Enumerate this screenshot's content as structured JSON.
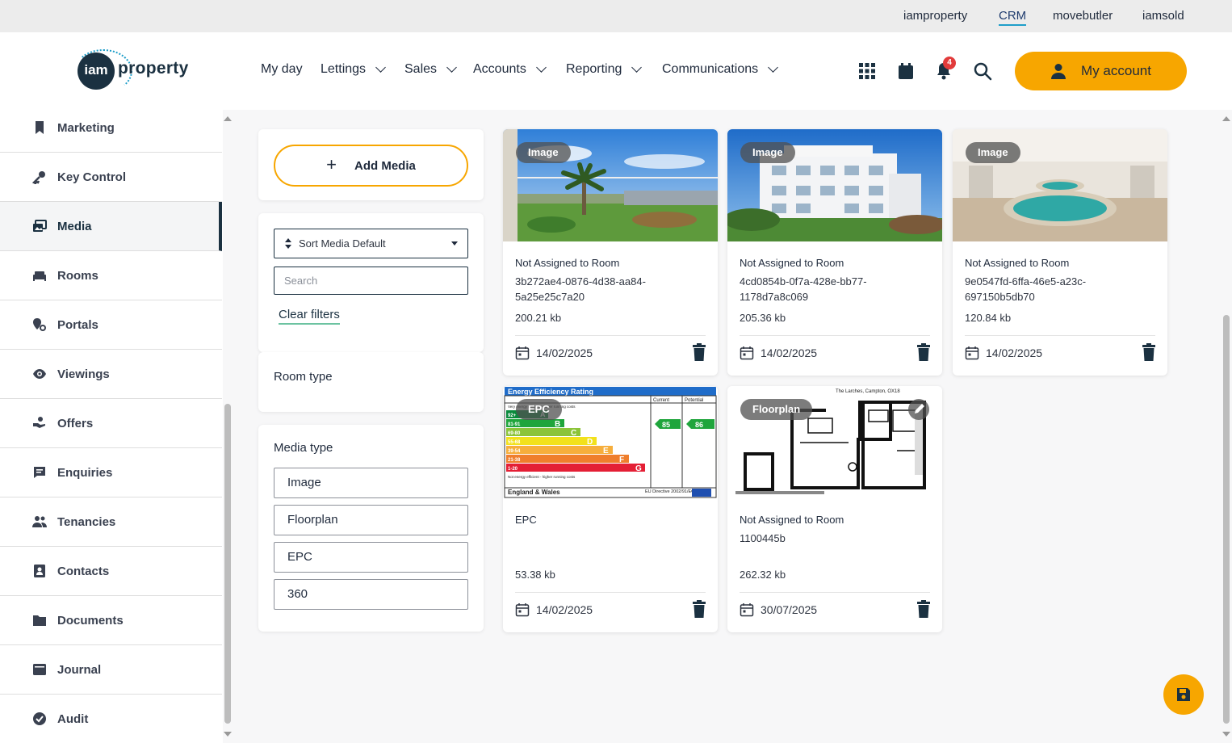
{
  "top_links": [
    "iamproperty",
    "CRM",
    "movebutler",
    "iamsold"
  ],
  "logo": {
    "mark": "iam",
    "word": "property"
  },
  "nav": [
    "My day",
    "Lettings",
    "Sales",
    "Accounts",
    "Reporting",
    "Communications"
  ],
  "notifications_count": "4",
  "account_label": "My account",
  "sidebar": [
    {
      "label": "Marketing",
      "icon": "bookmark-icon"
    },
    {
      "label": "Key Control",
      "icon": "key-icon"
    },
    {
      "label": "Media",
      "icon": "media-icon",
      "active": true
    },
    {
      "label": "Rooms",
      "icon": "bed-icon"
    },
    {
      "label": "Portals",
      "icon": "portal-icon"
    },
    {
      "label": "Viewings",
      "icon": "eye-icon"
    },
    {
      "label": "Offers",
      "icon": "hand-coin-icon"
    },
    {
      "label": "Enquiries",
      "icon": "message-icon"
    },
    {
      "label": "Tenancies",
      "icon": "people-icon"
    },
    {
      "label": "Contacts",
      "icon": "contact-card-icon"
    },
    {
      "label": "Documents",
      "icon": "folder-icon"
    },
    {
      "label": "Journal",
      "icon": "journal-icon"
    },
    {
      "label": "Audit",
      "icon": "check-circle-icon"
    }
  ],
  "filters": {
    "add_media": "Add Media",
    "sort_value": "Sort Media Default",
    "search_placeholder": "Search",
    "clear_filters": "Clear filters",
    "room_type_title": "Room type",
    "media_type_title": "Media type",
    "media_types": [
      "Image",
      "Floorplan",
      "EPC",
      "360"
    ]
  },
  "media": [
    {
      "tag": "Image",
      "room": "Not Assigned to Room",
      "id": "3b272ae4-0876-4d38-aa84-5a25e25c7a20",
      "size": "200.21 kb",
      "date": "14/02/2025"
    },
    {
      "tag": "Image",
      "room": "Not Assigned to Room",
      "id": "4cd0854b-0f7a-428e-bb77-1178d7a8c069",
      "size": "205.36 kb",
      "date": "14/02/2025"
    },
    {
      "tag": "Image",
      "room": "Not Assigned to Room",
      "id": "9e0547fd-6ffa-46e5-a23c-697150b5db70",
      "size": "120.84 kb",
      "date": "14/02/2025"
    },
    {
      "tag": "EPC",
      "room": "EPC",
      "id": "",
      "size": "53.38 kb",
      "date": "14/02/2025"
    },
    {
      "tag": "Floorplan",
      "room": "Not Assigned to Room",
      "id": "1100445b",
      "size": "262.32 kb",
      "date": "30/07/2025"
    }
  ],
  "epc_image": {
    "title": "Energy Efficiency Rating",
    "current_label": "Current",
    "potential_label": "Potential",
    "current": "85",
    "potential": "86",
    "band_ranges": [
      "92+",
      "81-91",
      "69-80",
      "55-68",
      "39-54",
      "21-38",
      "1-20"
    ],
    "band_letters": [
      "A",
      "B",
      "C",
      "D",
      "E",
      "F",
      "G"
    ],
    "top_note": "Very energy efficient - lower running costs",
    "bottom_note": "Not energy efficient - higher running costs",
    "region": "England & Wales",
    "directive": "EU Directive 2002/91/EC"
  },
  "floorplan_image": {
    "heading": "The Larches, Campton, OX18"
  },
  "colors": {
    "accent": "#f7a600",
    "brand_dark": "#1b3141",
    "alert": "#e23b3b"
  }
}
